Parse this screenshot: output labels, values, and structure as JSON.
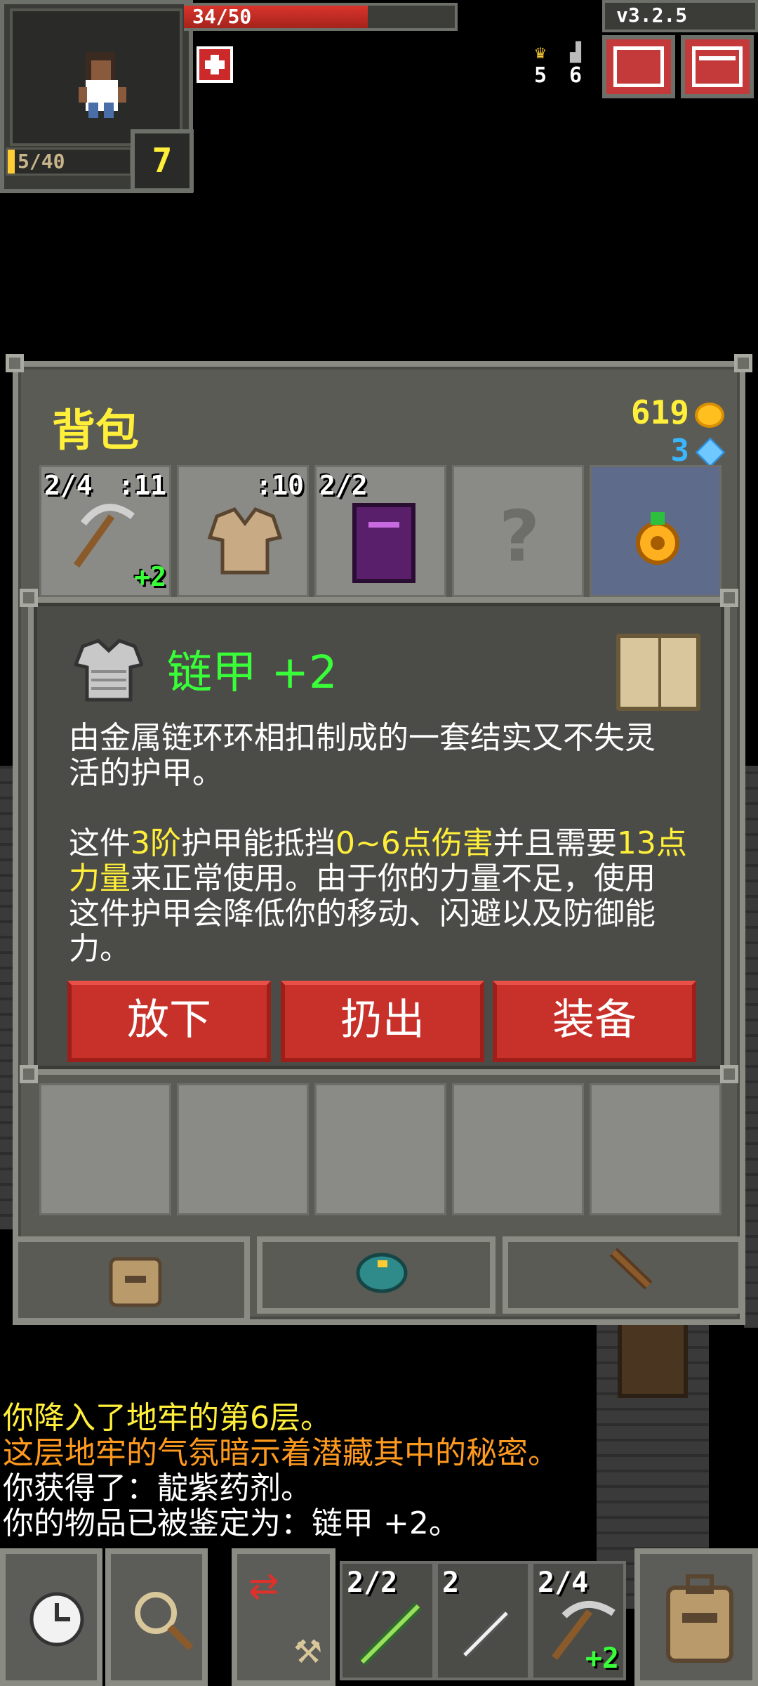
{
  "status": {
    "hp_text": "34/50",
    "hp_fraction": 0.68,
    "xp_text": "5/40",
    "level": "7",
    "version": "v3.2.5",
    "trophy_count": "5",
    "depth_count": "6"
  },
  "icons": {
    "trophy": "trophy-icon",
    "stairs": "stairs-icon",
    "journal": "journal-icon",
    "menu": "menu-icon",
    "buff": "health-buff-icon"
  },
  "inventory": {
    "title": "背包",
    "gold": "619",
    "gems": "3",
    "slots": [
      {
        "item": "pickaxe",
        "top_left": "2/4",
        "top_right": ":11",
        "bottom_right": "+2"
      },
      {
        "item": "cloth-armor",
        "top_left": "",
        "top_right": ":10",
        "bottom_right": ""
      },
      {
        "item": "spellbook",
        "top_left": "2/2",
        "top_right": "",
        "bottom_right": ""
      },
      {
        "item": "unknown",
        "top_left": "",
        "top_right": "",
        "bottom_right": ""
      },
      {
        "item": "amulet",
        "top_left": "",
        "top_right": "",
        "bottom_right": "",
        "selected": true
      }
    ]
  },
  "item_info": {
    "title": "链甲 +2",
    "desc_line1": "由金属链环环相扣制成的一套结实又不失灵",
    "desc_line2": "活的护甲。",
    "p2_a": "这件",
    "p2_tier": "3阶",
    "p2_b": "护甲能抵挡",
    "p2_block": "0~6点伤害",
    "p2_c": "并且需要",
    "p2_str": "13点",
    "p2_str2": "力量",
    "p2_d": "来正常使用。由于你的力量不足，使用",
    "p2_e": "这件护甲会降低你的移动、闪避以及防御能",
    "p2_f": "力。",
    "buttons": {
      "drop": "放下",
      "throw": "扔出",
      "equip": "装备"
    }
  },
  "log": [
    {
      "text": "你降入了地牢的第6层。",
      "color": "#ffef3a"
    },
    {
      "text": "这层地牢的气氛暗示着潜藏其中的秘密。",
      "color": "#ff9a1f"
    },
    {
      "text": "你获得了：靛紫药剂。",
      "color": "#ffffff"
    },
    {
      "text": "你的物品已被鉴定为：链甲 +2。",
      "color": "#ffffff"
    }
  ],
  "quickslots": [
    {
      "item": "wand-green",
      "count": "2/2",
      "bonus": ""
    },
    {
      "item": "dart",
      "count": "2",
      "bonus": ""
    },
    {
      "item": "pickaxe",
      "count": "2/4",
      "bonus": "+2"
    }
  ],
  "toolbar": {
    "wait": "clock-icon",
    "search": "magnifier-icon",
    "backpack": "backpack-icon"
  }
}
